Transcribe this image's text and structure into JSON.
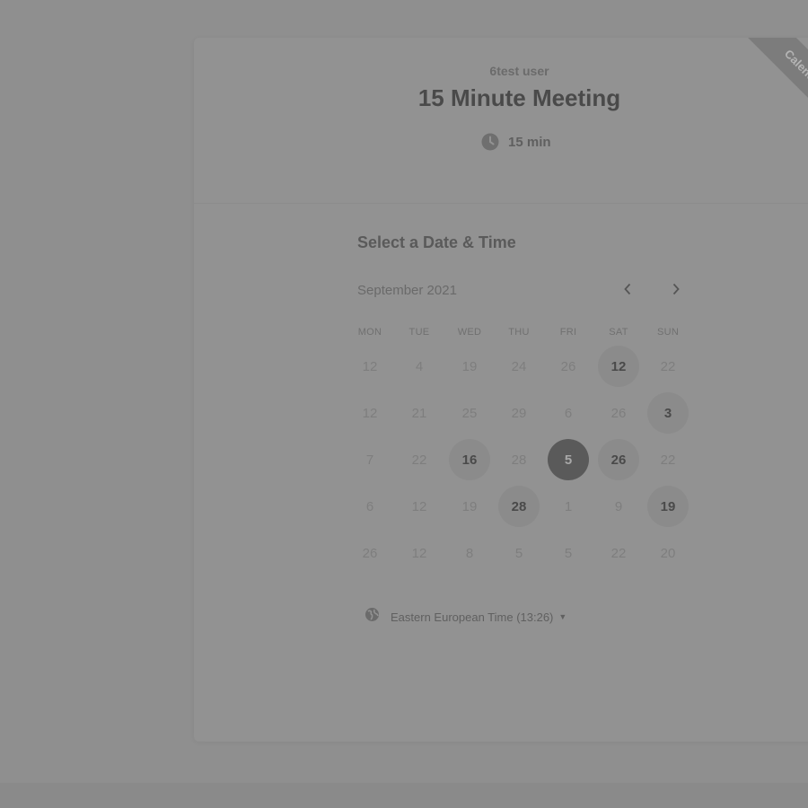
{
  "event": {
    "owner": "6test user",
    "title": "15 Minute Meeting",
    "duration": "15 min",
    "ribbon_text": "Calendly"
  },
  "calendar": {
    "section_title": "Select a Date & Time",
    "month": "September 2021",
    "weekdays": [
      "MON",
      "TUE",
      "WED",
      "THU",
      "FRI",
      "SAT",
      "SUN"
    ],
    "weeks": [
      [
        {
          "d": "12"
        },
        {
          "d": "4"
        },
        {
          "d": "19"
        },
        {
          "d": "24"
        },
        {
          "d": "26"
        },
        {
          "d": "12",
          "s": "available"
        },
        {
          "d": "22"
        }
      ],
      [
        {
          "d": "12"
        },
        {
          "d": "21"
        },
        {
          "d": "25"
        },
        {
          "d": "29"
        },
        {
          "d": "6"
        },
        {
          "d": "26"
        },
        {
          "d": "3",
          "s": "available"
        }
      ],
      [
        {
          "d": "7"
        },
        {
          "d": "22"
        },
        {
          "d": "16",
          "s": "available"
        },
        {
          "d": "28"
        },
        {
          "d": "5",
          "s": "selected"
        },
        {
          "d": "26",
          "s": "available"
        },
        {
          "d": "22"
        }
      ],
      [
        {
          "d": "6"
        },
        {
          "d": "12"
        },
        {
          "d": "19"
        },
        {
          "d": "28",
          "s": "available"
        },
        {
          "d": "1"
        },
        {
          "d": "9"
        },
        {
          "d": "19",
          "s": "available"
        }
      ],
      [
        {
          "d": "26"
        },
        {
          "d": "12"
        },
        {
          "d": "8"
        },
        {
          "d": "5"
        },
        {
          "d": "5"
        },
        {
          "d": "22"
        },
        {
          "d": "20"
        }
      ]
    ],
    "timezone": "Eastern European Time (13:26)"
  },
  "icons": {
    "duration": "clock-icon",
    "prev": "chevron-left-icon",
    "next": "chevron-right-icon",
    "timezone": "globe-icon",
    "dropdown": "caret-down-icon"
  },
  "colors": {
    "selected_day_bg": "#5a5a5a",
    "available_day_bg": "#8b8b8b",
    "page_bg": "#8f8f8f"
  }
}
